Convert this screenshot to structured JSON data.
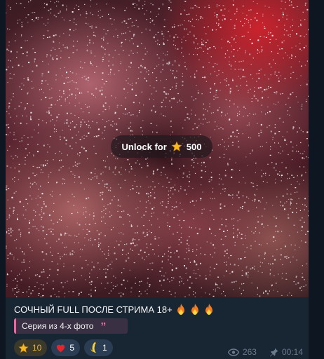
{
  "unlock": {
    "label": "Unlock for",
    "amount": "500",
    "icon": "star-icon"
  },
  "caption": {
    "text": "СОЧНЫЙ  FULL ПОСЛЕ СТРИМА 18+",
    "emoji": [
      "fire-icon",
      "fire-icon",
      "fire-icon"
    ]
  },
  "quote": {
    "text": "Серия из 4-х фото",
    "accent_color": "#e86aa0"
  },
  "reactions": [
    {
      "icon": "star-icon",
      "count": "10"
    },
    {
      "icon": "heart-icon",
      "count": "5"
    },
    {
      "icon": "banana-icon",
      "count": "1"
    }
  ],
  "meta": {
    "views": "263",
    "time": "00:14",
    "views_icon": "eye-icon",
    "pin_icon": "pin-icon"
  },
  "colors": {
    "background": "#0e1621",
    "bubble": "#182533",
    "star": "#f6b820",
    "heart": "#e3262e",
    "meta_text": "#6c7b8c"
  }
}
